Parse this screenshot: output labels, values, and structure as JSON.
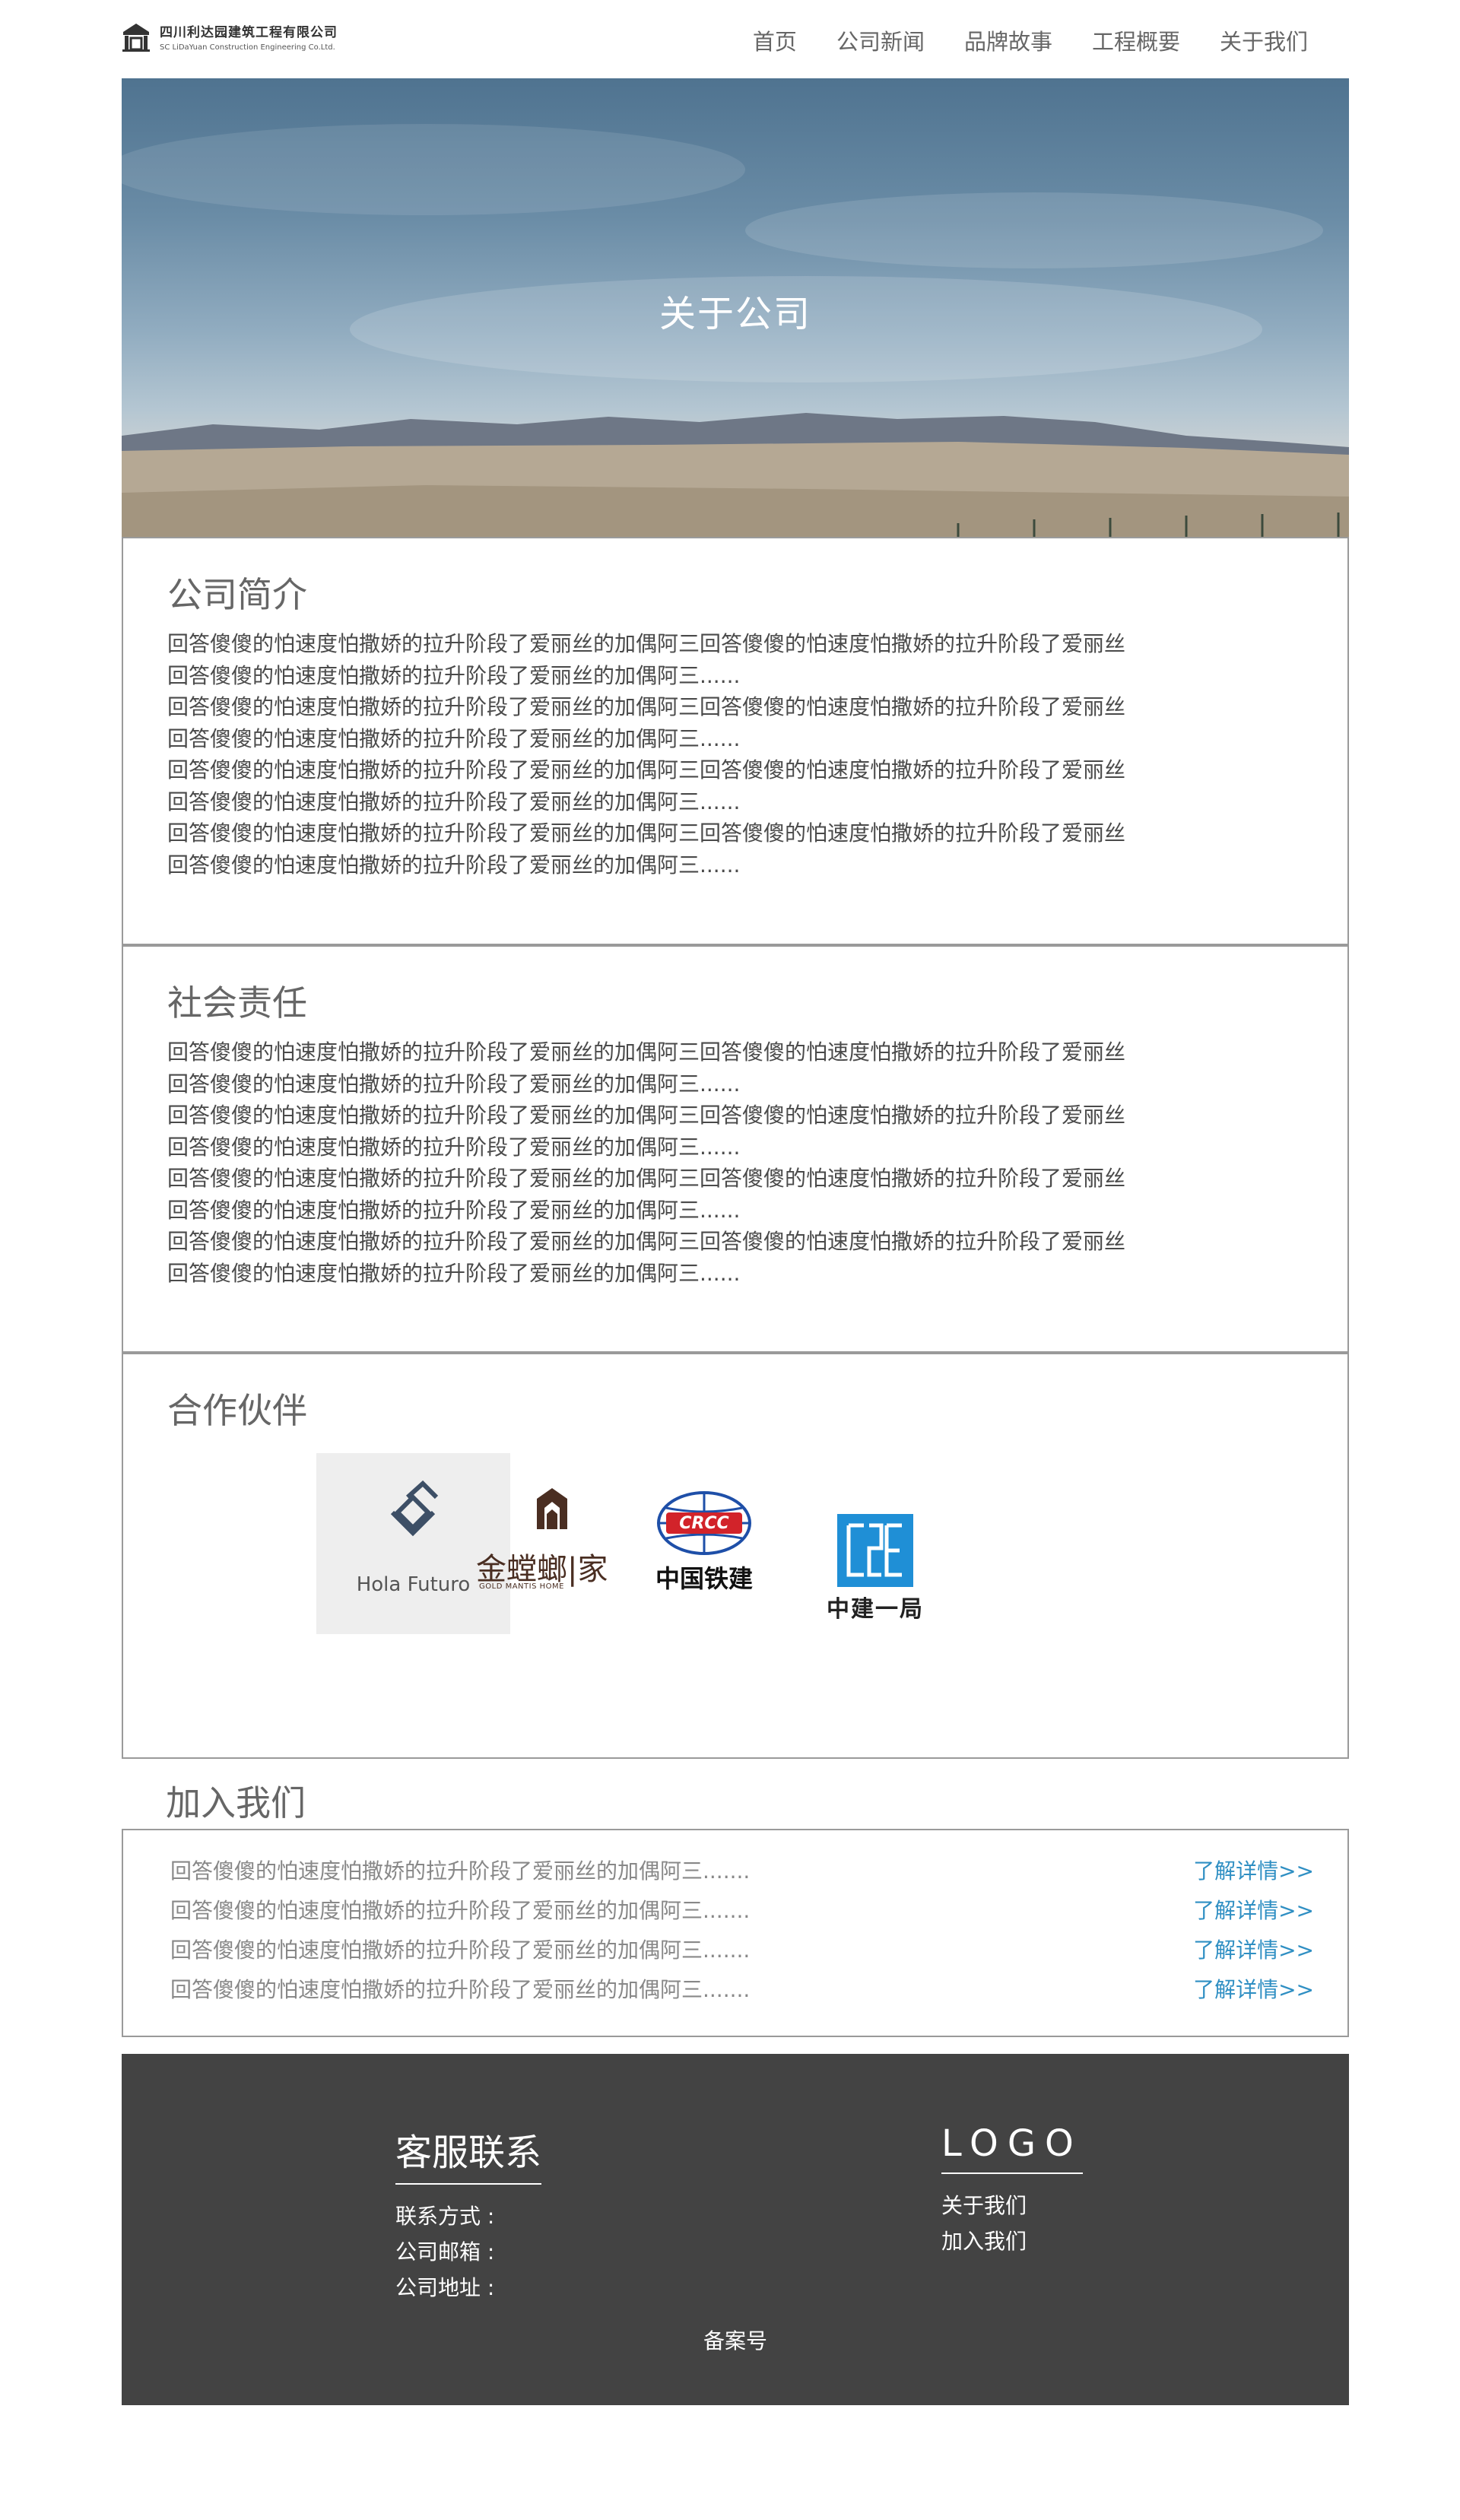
{
  "header": {
    "company_cn": "四川利达园建筑工程有限公司",
    "company_en": "SC LiDaYuan Construction Engineering Co.Ltd.",
    "nav": [
      "首页",
      "公司新闻",
      "品牌故事",
      "工程概要",
      "关于我们"
    ]
  },
  "hero": {
    "title": "关于公司"
  },
  "intro": {
    "title": "公司简介",
    "lines": [
      "回答傻傻的怕速度怕撒娇的拉升阶段了爱丽丝的加偶阿三回答傻傻的怕速度怕撒娇的拉升阶段了爱丽丝",
      "回答傻傻的怕速度怕撒娇的拉升阶段了爱丽丝的加偶阿三......",
      "回答傻傻的怕速度怕撒娇的拉升阶段了爱丽丝的加偶阿三回答傻傻的怕速度怕撒娇的拉升阶段了爱丽丝",
      "回答傻傻的怕速度怕撒娇的拉升阶段了爱丽丝的加偶阿三......",
      "回答傻傻的怕速度怕撒娇的拉升阶段了爱丽丝的加偶阿三回答傻傻的怕速度怕撒娇的拉升阶段了爱丽丝",
      "回答傻傻的怕速度怕撒娇的拉升阶段了爱丽丝的加偶阿三......",
      "回答傻傻的怕速度怕撒娇的拉升阶段了爱丽丝的加偶阿三回答傻傻的怕速度怕撒娇的拉升阶段了爱丽丝",
      "回答傻傻的怕速度怕撒娇的拉升阶段了爱丽丝的加偶阿三......"
    ]
  },
  "responsibility": {
    "title": "社会责任",
    "lines": [
      "回答傻傻的怕速度怕撒娇的拉升阶段了爱丽丝的加偶阿三回答傻傻的怕速度怕撒娇的拉升阶段了爱丽丝",
      "回答傻傻的怕速度怕撒娇的拉升阶段了爱丽丝的加偶阿三......",
      "回答傻傻的怕速度怕撒娇的拉升阶段了爱丽丝的加偶阿三回答傻傻的怕速度怕撒娇的拉升阶段了爱丽丝",
      "回答傻傻的怕速度怕撒娇的拉升阶段了爱丽丝的加偶阿三......",
      "回答傻傻的怕速度怕撒娇的拉升阶段了爱丽丝的加偶阿三回答傻傻的怕速度怕撒娇的拉升阶段了爱丽丝",
      "回答傻傻的怕速度怕撒娇的拉升阶段了爱丽丝的加偶阿三......",
      "回答傻傻的怕速度怕撒娇的拉升阶段了爱丽丝的加偶阿三回答傻傻的怕速度怕撒娇的拉升阶段了爱丽丝",
      "回答傻傻的怕速度怕撒娇的拉升阶段了爱丽丝的加偶阿三......"
    ]
  },
  "partners": {
    "title": "合作伙伴",
    "items": [
      {
        "name": "Hola Futuro",
        "icon": "hola-futuro-logo"
      },
      {
        "name": "金螳螂|家",
        "sub": "GOLD MANTIS HOME",
        "icon": "gold-mantis-logo"
      },
      {
        "name": "中国铁建",
        "badge": "CRCC",
        "icon": "crcc-logo"
      },
      {
        "name": "中建一局",
        "icon": "cscec-logo"
      }
    ]
  },
  "join": {
    "title": "加入我们",
    "rows": [
      {
        "text": "回答傻傻的怕速度怕撒娇的拉升阶段了爱丽丝的加偶阿三.......",
        "link": "了解详情>>"
      },
      {
        "text": "回答傻傻的怕速度怕撒娇的拉升阶段了爱丽丝的加偶阿三.......",
        "link": "了解详情>>"
      },
      {
        "text": "回答傻傻的怕速度怕撒娇的拉升阶段了爱丽丝的加偶阿三.......",
        "link": "了解详情>>"
      },
      {
        "text": "回答傻傻的怕速度怕撒娇的拉升阶段了爱丽丝的加偶阿三.......",
        "link": "了解详情>>"
      }
    ]
  },
  "footer": {
    "contact_title": "客服联系",
    "contact_items": [
      "联系方式 :",
      "公司邮箱 :",
      "公司地址 :"
    ],
    "logo_title": "LOGO",
    "links": [
      "关于我们",
      "加入我们"
    ],
    "record": "备案号"
  },
  "colors": {
    "link": "#2f8fc3",
    "footer_bg": "#434343",
    "border": "#9a9a9a"
  }
}
